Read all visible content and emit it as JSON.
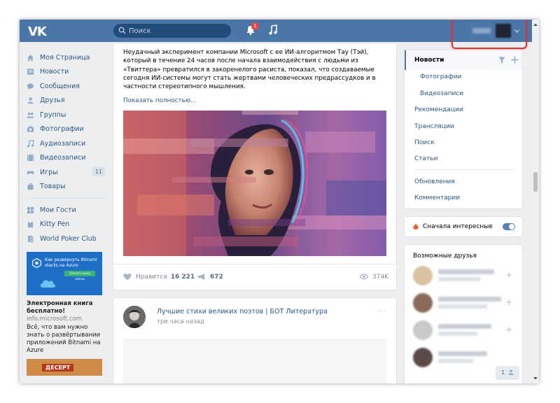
{
  "header": {
    "logo": "VK",
    "search_placeholder": "Поиск",
    "notifications_badge": "1",
    "accent_color": "#4a76a8"
  },
  "left_nav": {
    "items": [
      {
        "label": "Моя Страница",
        "icon": "home-icon"
      },
      {
        "label": "Новости",
        "icon": "news-icon"
      },
      {
        "label": "Сообщения",
        "icon": "messages-icon"
      },
      {
        "label": "Друзья",
        "icon": "friends-icon"
      },
      {
        "label": "Группы",
        "icon": "groups-icon"
      },
      {
        "label": "Фотографии",
        "icon": "camera-icon"
      },
      {
        "label": "Аудиозаписи",
        "icon": "music-icon"
      },
      {
        "label": "Видеозаписи",
        "icon": "film-icon"
      },
      {
        "label": "Игры",
        "icon": "gamepad-icon",
        "count": "11"
      },
      {
        "label": "Товары",
        "icon": "bag-icon"
      }
    ],
    "apps": [
      {
        "label": "Мои Гости",
        "icon": "app-grid-icon"
      },
      {
        "label": "Kitty Pen",
        "icon": "app-cat-icon"
      },
      {
        "label": "World Poker Club",
        "icon": "app-poker-icon"
      }
    ],
    "ad": {
      "banner_text": "Как развернуть Bitnami stacks на Azure",
      "banner_button": "Скачать книгу сейчас",
      "title": "Электронная книга бесплатно!",
      "url": "info.microsoft.com",
      "description": "Всё, что вам нужно знать о развёртывании приложений Bitnami на Azure"
    },
    "ad2_label": "ДЕСЕРТ"
  },
  "post1": {
    "text": "Неудачный эксперимент компании Microsoft с ее ИИ-алгоритмом Тау (Тэй), который в течение 24 часов после начала взаимодействия с людьми из «Твиттера» превратился в закоренелого расиста, показал, что создаваемые сегодня ИИ-системы могут стать жертвами человеческих предрассудков и в частности стереотипного мышления.",
    "show_more": "Показать полностью…",
    "like_label": "Нравится",
    "likes": "16 221",
    "shares": "672",
    "views": "374K"
  },
  "post2": {
    "author": "Лучшие стихи великих поэтов | БОТ Литература",
    "time": "три часа назад",
    "menu": "···"
  },
  "right_menu": {
    "active": "Новости",
    "sub_items": [
      "Фотографии",
      "Видеозаписи"
    ],
    "items_a": [
      "Рекомендации",
      "Трансляции",
      "Поиск",
      "Статьи"
    ],
    "items_b": [
      "Обновления",
      "Комментарии"
    ]
  },
  "interesting": {
    "label": "Сначала интересные",
    "enabled": true
  },
  "friends": {
    "title": "Возможные друзья",
    "count": "1"
  }
}
